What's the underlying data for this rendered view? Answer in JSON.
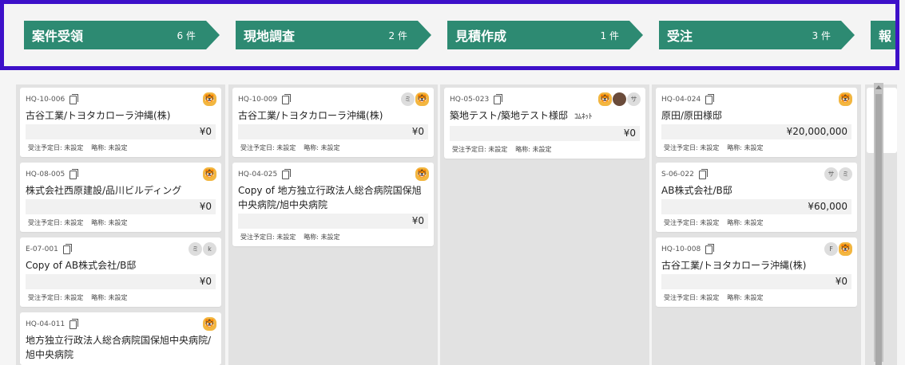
{
  "stages": [
    {
      "name": "案件受領",
      "count": "6 件"
    },
    {
      "name": "現地調査",
      "count": "2 件"
    },
    {
      "name": "見積作成",
      "count": "1 件"
    },
    {
      "name": "受注",
      "count": "3 件"
    },
    {
      "name": "報"
    }
  ],
  "colors": {
    "stage_bg": "#2d8a72",
    "border": "#3d10c9"
  },
  "columns": [
    {
      "cards": [
        {
          "code": "HQ-10-006",
          "title": "古谷工業/トヨタカローラ沖縄(株)",
          "amount": "¥0",
          "meta1": "受注予定日: 未設定",
          "meta2": "略称: 未設定",
          "avatars": [
            "tiger"
          ]
        },
        {
          "code": "HQ-08-005",
          "title": "株式会社西原建設/品川ビルディング",
          "amount": "¥0",
          "meta1": "受注予定日: 未設定",
          "meta2": "略称: 未設定",
          "avatars": [
            "tiger"
          ]
        },
        {
          "code": "E-07-001",
          "title": "Copy of AB株式会社/B邸",
          "amount": "¥0",
          "meta1": "受注予定日: 未設定",
          "meta2": "略称: 未設定",
          "avatars": [
            "ミ",
            "k"
          ]
        },
        {
          "code": "HQ-04-011",
          "title": "地方独立行政法人総合病院国保旭中央病院/旭中央病院",
          "amount": "",
          "meta1": "",
          "meta2": "",
          "avatars": [
            "tiger"
          ]
        }
      ]
    },
    {
      "cards": [
        {
          "code": "HQ-10-009",
          "title": "古谷工業/トヨタカローラ沖縄(株)",
          "amount": "¥0",
          "meta1": "受注予定日: 未設定",
          "meta2": "略称: 未設定",
          "avatars": [
            "ミ",
            "tiger"
          ]
        },
        {
          "code": "HQ-04-025",
          "title": "Copy of 地方独立行政法人総合病院国保旭中央病院/旭中央病院",
          "amount": "¥0",
          "meta1": "受注予定日: 未設定",
          "meta2": "略称: 未設定",
          "avatars": [
            "tiger"
          ]
        }
      ]
    },
    {
      "cards": [
        {
          "code": "HQ-05-023",
          "title": "築地テスト/築地テスト様邸",
          "extra": "ｺﾑﾈｯﾄ",
          "amount": "¥0",
          "meta1": "受注予定日: 未設定",
          "meta2": "略称: 未設定",
          "avatars": [
            "tiger",
            "photo",
            "サ"
          ]
        }
      ]
    },
    {
      "cards": [
        {
          "code": "HQ-04-024",
          "title": "原田/原田様邸",
          "amount": "¥20,000,000",
          "meta1": "受注予定日: 未設定",
          "meta2": "略称: 未設定",
          "avatars": [
            "tiger"
          ]
        },
        {
          "code": "S-06-022",
          "title": "AB株式会社/B邸",
          "amount": "¥60,000",
          "meta1": "受注予定日: 未設定",
          "meta2": "略称: 未設定",
          "avatars": [
            "サ",
            "ミ"
          ]
        },
        {
          "code": "HQ-10-008",
          "title": "古谷工業/トヨタカローラ沖縄(株)",
          "amount": "¥0",
          "meta1": "受注予定日: 未設定",
          "meta2": "略称: 未設定",
          "avatars": [
            "F",
            "tiger"
          ]
        }
      ]
    }
  ]
}
